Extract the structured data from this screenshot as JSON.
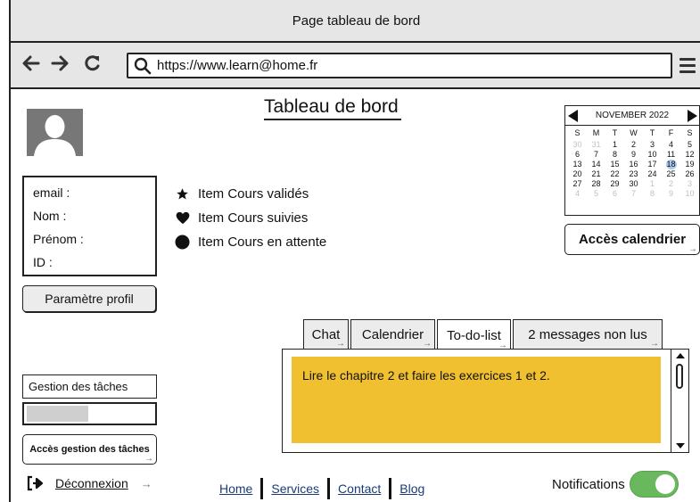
{
  "window": {
    "title": "Page tableau de bord"
  },
  "browser": {
    "url": "https://www.learn@home.fr",
    "back_icon": "arrow-left-icon",
    "forward_icon": "arrow-right-icon",
    "reload_icon": "reload-icon",
    "search_icon": "search-icon",
    "menu_icon": "hamburger-icon"
  },
  "page": {
    "title": "Tableau de bord"
  },
  "profile": {
    "fields": [
      {
        "label": "email :"
      },
      {
        "label": "Nom :"
      },
      {
        "label": "Prénom :"
      },
      {
        "label": "ID :"
      }
    ],
    "settings_button": "Paramètre profil"
  },
  "legend": [
    {
      "icon": "star-icon",
      "label": "Item Cours validés"
    },
    {
      "icon": "heart-icon",
      "label": "Item Cours suivies"
    },
    {
      "icon": "circle-icon",
      "label": "Item Cours en attente"
    }
  ],
  "calendar": {
    "month": "NOVEMBER 2022",
    "weekdays": [
      "S",
      "M",
      "T",
      "W",
      "T",
      "F",
      "S"
    ],
    "weeks": [
      [
        {
          "d": "30",
          "m": true
        },
        {
          "d": "31",
          "m": true
        },
        {
          "d": "1"
        },
        {
          "d": "2"
        },
        {
          "d": "3"
        },
        {
          "d": "4"
        },
        {
          "d": "5"
        }
      ],
      [
        {
          "d": "6"
        },
        {
          "d": "7"
        },
        {
          "d": "8"
        },
        {
          "d": "9"
        },
        {
          "d": "10"
        },
        {
          "d": "11"
        },
        {
          "d": "12"
        }
      ],
      [
        {
          "d": "13"
        },
        {
          "d": "14"
        },
        {
          "d": "15"
        },
        {
          "d": "16"
        },
        {
          "d": "17"
        },
        {
          "d": "18",
          "s": true
        },
        {
          "d": "19"
        }
      ],
      [
        {
          "d": "20"
        },
        {
          "d": "21"
        },
        {
          "d": "22"
        },
        {
          "d": "23"
        },
        {
          "d": "24"
        },
        {
          "d": "25"
        },
        {
          "d": "26"
        }
      ],
      [
        {
          "d": "27"
        },
        {
          "d": "28"
        },
        {
          "d": "29"
        },
        {
          "d": "30"
        },
        {
          "d": "1",
          "m": true
        },
        {
          "d": "2",
          "m": true
        },
        {
          "d": "3",
          "m": true
        }
      ],
      [
        {
          "d": "4",
          "m": true
        },
        {
          "d": "5",
          "m": true
        },
        {
          "d": "6",
          "m": true
        },
        {
          "d": "7",
          "m": true
        },
        {
          "d": "8",
          "m": true
        },
        {
          "d": "9",
          "m": true
        },
        {
          "d": "10",
          "m": true
        }
      ]
    ],
    "access_button": "Accès calendrier"
  },
  "tabs": [
    {
      "label": "Chat",
      "active": false
    },
    {
      "label": "Calendrier",
      "active": false
    },
    {
      "label": "To-do-list",
      "active": true
    },
    {
      "label": "2 messages non lus",
      "active": false
    }
  ],
  "todo": {
    "note": "Lire le chapitre 2 et faire les exercices 1 et 2."
  },
  "tasks": {
    "label": "Gestion des tâches",
    "access_button": "Accès gestion des tâches"
  },
  "logout": {
    "label": "Déconnexion"
  },
  "footer": {
    "links": [
      "Home",
      "Services",
      "Contact",
      "Blog"
    ]
  },
  "notifications": {
    "label": "Notifications",
    "enabled": true
  },
  "colors": {
    "note_bg": "#f0c030",
    "toggle_on": "#6ab85e",
    "link": "#1a3b7a",
    "chrome_bg": "#e6e6e6"
  }
}
